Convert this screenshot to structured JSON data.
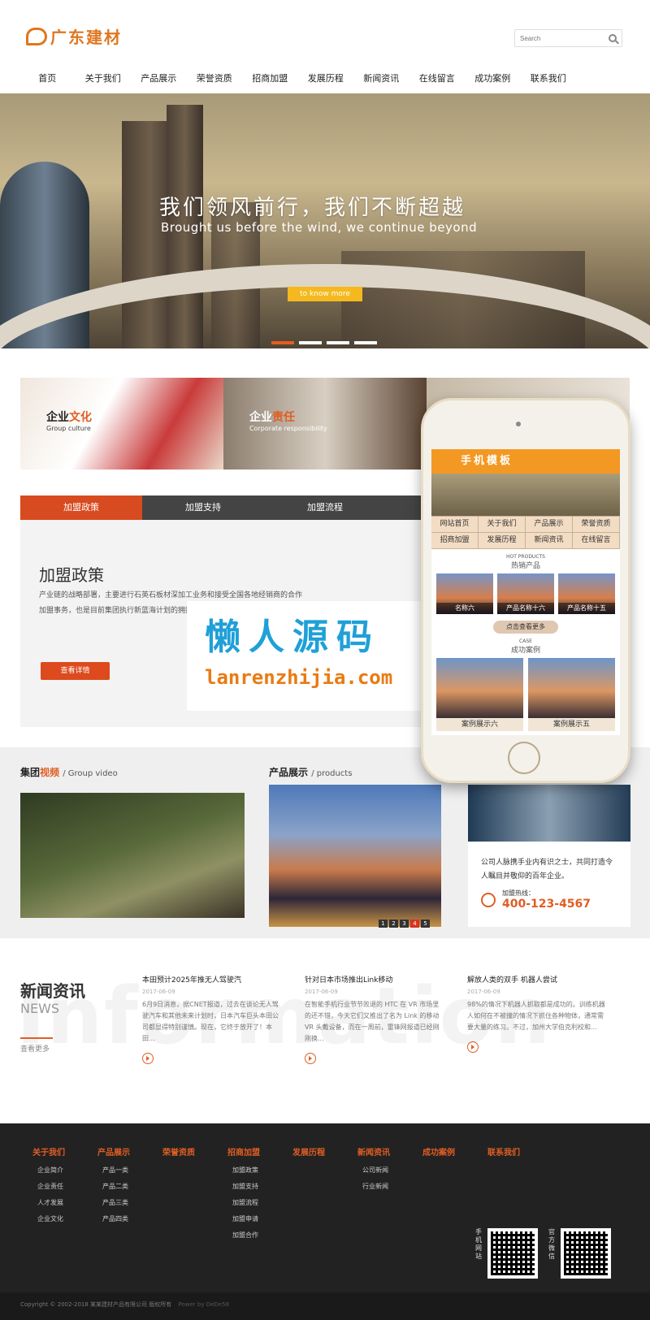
{
  "header": {
    "logo_text": "广东建材",
    "search_placeholder": "Search"
  },
  "nav": [
    "首页",
    "关于我们",
    "产品展示",
    "荣誉资质",
    "招商加盟",
    "发展历程",
    "新闻资讯",
    "在线留言",
    "成功案例",
    "联系我们"
  ],
  "banner": {
    "title": "我们领风前行，我们不断超越",
    "subtitle": "Brought us before the wind, we continue beyond",
    "button": "to know more"
  },
  "culture": [
    {
      "label_a": "企业",
      "label_b": "文化",
      "sub": "Group culture"
    },
    {
      "label_a": "企业",
      "label_b": "责任",
      "sub": "Corporate responsibility"
    }
  ],
  "tabs": [
    "加盟政策",
    "加盟支持",
    "加盟流程"
  ],
  "tab_panel": {
    "title": "加盟政策",
    "text": "产业链的战略部署，主要进行石英石板材深加工业务和接受全国各地经销商的合作加盟事务，也是目前集团执行新蓝海计划的拥抱",
    "button": "查看详情"
  },
  "watermark": {
    "cn": "懒人源码",
    "en": "lanrenzhijia.com"
  },
  "phone": {
    "header": "手机模板",
    "menu": [
      "网站首页",
      "关于我们",
      "产品展示",
      "荣誉资质",
      "招商加盟",
      "发展历程",
      "新闻资讯",
      "在线留言"
    ],
    "hot_en": "HOT PRODUCTS",
    "hot_cn": "热销产品",
    "products": [
      "名称六",
      "产品名称十六",
      "产品名称十五"
    ],
    "more": "点击查看更多",
    "case_en": "CASE",
    "case_cn": "成功案例",
    "cases": [
      "案例展示六",
      "案例展示五"
    ]
  },
  "video_section": {
    "title_a": "集团",
    "title_b": "视频",
    "en": "/ Group video"
  },
  "products_section": {
    "title": "产品展示",
    "en": "/ products"
  },
  "pager": [
    "1",
    "2",
    "3",
    "4",
    "5"
  ],
  "contact": {
    "text": "公司人脉携手业内有识之士，共同打造令人瞩目并敬仰的百年企业。",
    "hotline_label": "加盟热线：",
    "hotline": "400-123-4567"
  },
  "news": {
    "bg_text": "Information",
    "title": "新闻资讯",
    "en": "NEWS",
    "more": "查看更多",
    "items": [
      {
        "title": "本田预计2025年推无人驾驶汽",
        "date": "2017-06-09",
        "text": "6月9日消息，据CNET报道，过去在谈论无人驾驶汽车和其他未来计划时，日本汽车巨头本田公司都显得特别谨慎。现在，它终于放开了！本田..."
      },
      {
        "title": "针对日本市场推出Link移动",
        "date": "2017-06-09",
        "text": "在智能手机行业节节败退的 HTC 在 VR 市场里的还不错，今天它们又推出了名为 Link 的移动 VR 头戴设备，而在一周前，雷锋网报道已经刚刚换..."
      },
      {
        "title": "解放人类的双手 机器人尝试",
        "date": "2017-06-09",
        "text": "98%的情况下机器人抓取都是成功的。训练机器人如何在不被撞的情况下抓住各种物体，通常需要大量的练习。不过，加州大学伯克利校和..."
      }
    ]
  },
  "footer": {
    "columns": [
      {
        "heading": "关于我们",
        "links": [
          "企业简介",
          "企业责任",
          "人才发展",
          "企业文化"
        ]
      },
      {
        "heading": "产品展示",
        "links": [
          "产品一类",
          "产品二类",
          "产品三类",
          "产品四类"
        ]
      },
      {
        "heading": "荣誉资质",
        "links": []
      },
      {
        "heading": "招商加盟",
        "links": [
          "加盟政策",
          "加盟支持",
          "加盟流程",
          "加盟申请",
          "加盟合作"
        ]
      },
      {
        "heading": "发展历程",
        "links": []
      },
      {
        "heading": "新闻资讯",
        "links": [
          "公司新闻",
          "行业新闻"
        ]
      },
      {
        "heading": "成功案例",
        "links": []
      },
      {
        "heading": "联系我们",
        "links": []
      }
    ],
    "qr_labels": [
      "手机网站",
      "官方微信"
    ],
    "copyright": "Copyright © 2002-2018 某某建材产品有限公司 版权所有",
    "powered": "Power by DeDe58"
  },
  "colors": {
    "accent": "#e05e23",
    "banner_button": "#f5b91f",
    "phone_header": "#f39822",
    "watermark_blue": "#1fa0d8",
    "watermark_orange": "#e87b14"
  }
}
